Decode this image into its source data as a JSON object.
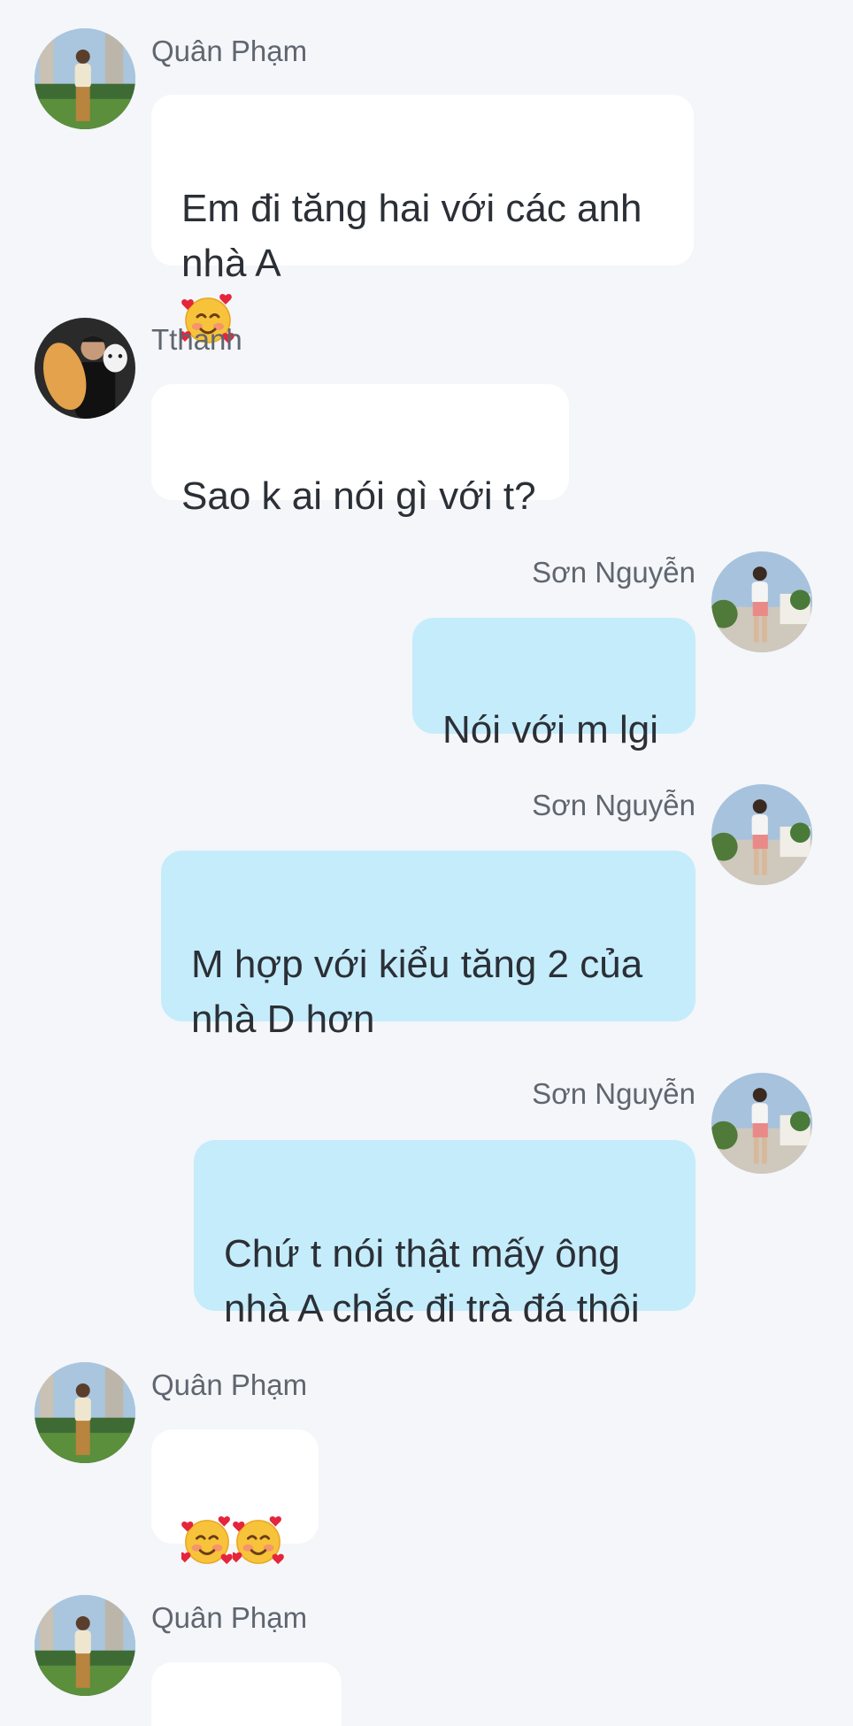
{
  "messages": [
    {
      "sender": "Quân Phạm",
      "text": "Em đi tăng hai với các anh\nnhà A",
      "emoji_after": "smiling-face-with-hearts",
      "direction": "incoming"
    },
    {
      "sender": "Tthanh",
      "text": "Sao k ai nói gì với t?",
      "direction": "incoming"
    },
    {
      "sender": "Sơn Nguyễn",
      "text": "Nói với m lgi",
      "direction": "outgoing"
    },
    {
      "sender": "Sơn Nguyễn",
      "text": "M hợp với kiểu tăng 2 của\nnhà D hơn",
      "direction": "outgoing"
    },
    {
      "sender": "Sơn Nguyễn",
      "text": "Chứ t nói thật mấy ông\nnhà A chắc đi trà đá thôi",
      "direction": "outgoing"
    },
    {
      "sender": "Quân Phạm",
      "text": "",
      "emojis": [
        "smiling-face-with-hearts",
        "smiling-face-with-hearts"
      ],
      "direction": "incoming"
    },
    {
      "sender": "Quân Phạm",
      "text": "",
      "direction": "incoming"
    }
  ],
  "colors": {
    "background": "#f4f6f9",
    "incoming_bubble": "#ffffff",
    "outgoing_bubble": "#c5ecfb",
    "sender_text": "#5f6670"
  }
}
